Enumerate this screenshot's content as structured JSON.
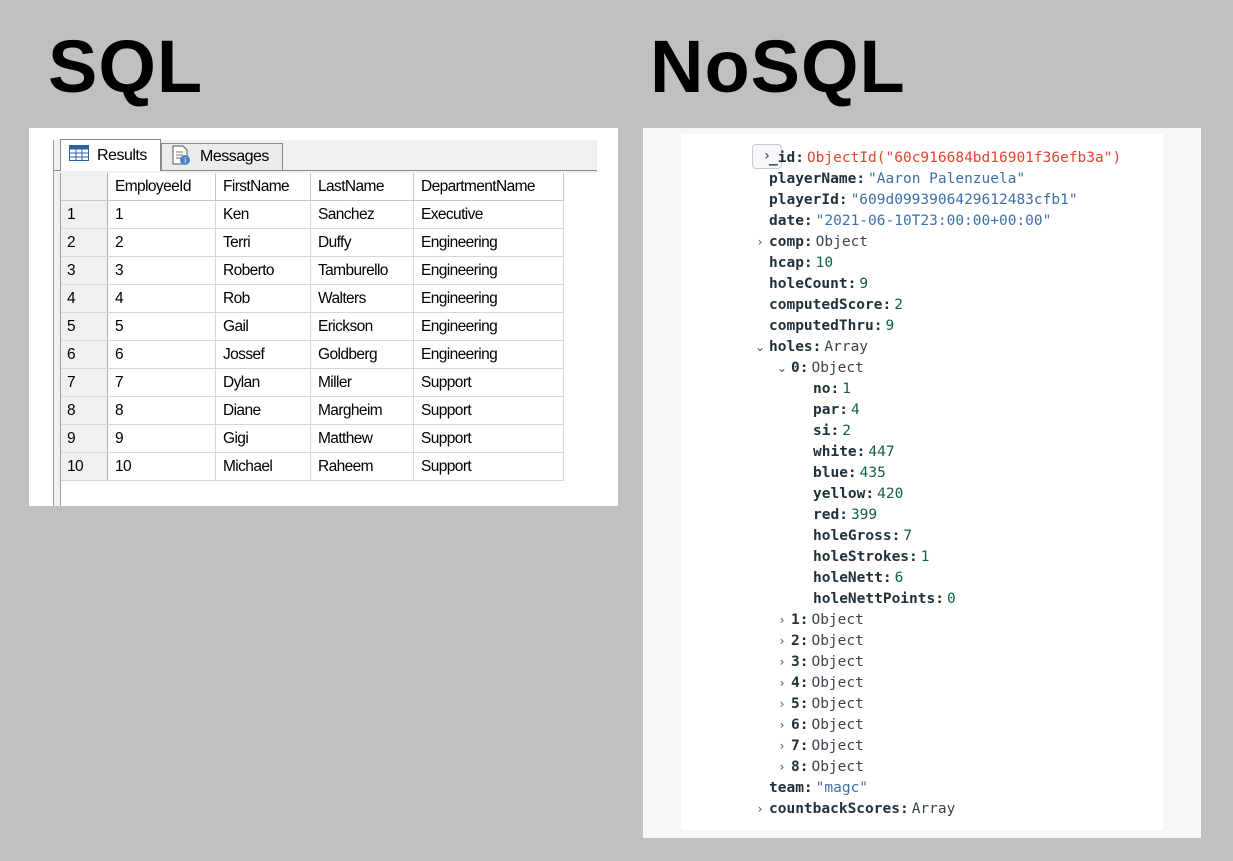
{
  "titles": {
    "sql": "SQL",
    "nosql": "NoSQL"
  },
  "sql": {
    "tabs": [
      {
        "label": "Results",
        "icon": "grid-icon"
      },
      {
        "label": "Messages",
        "icon": "messages-icon"
      }
    ],
    "columns": [
      "EmployeeId",
      "FirstName",
      "LastName",
      "DepartmentName"
    ],
    "rows": [
      {
        "num": "1",
        "id": "1",
        "first": "Ken",
        "last": "Sanchez",
        "dept": "Executive"
      },
      {
        "num": "2",
        "id": "2",
        "first": "Terri",
        "last": "Duffy",
        "dept": "Engineering"
      },
      {
        "num": "3",
        "id": "3",
        "first": "Roberto",
        "last": "Tamburello",
        "dept": "Engineering"
      },
      {
        "num": "4",
        "id": "4",
        "first": "Rob",
        "last": "Walters",
        "dept": "Engineering"
      },
      {
        "num": "5",
        "id": "5",
        "first": "Gail",
        "last": "Erickson",
        "dept": "Engineering"
      },
      {
        "num": "6",
        "id": "6",
        "first": "Jossef",
        "last": "Goldberg",
        "dept": "Engineering"
      },
      {
        "num": "7",
        "id": "7",
        "first": "Dylan",
        "last": "Miller",
        "dept": "Support"
      },
      {
        "num": "8",
        "id": "8",
        "first": "Diane",
        "last": "Margheim",
        "dept": "Support"
      },
      {
        "num": "9",
        "id": "9",
        "first": "Gigi",
        "last": "Matthew",
        "dept": "Support"
      },
      {
        "num": "10",
        "id": "10",
        "first": "Michael",
        "last": "Raheem",
        "dept": "Support"
      }
    ]
  },
  "nosql": {
    "expand_symbol": "›",
    "lines": [
      {
        "indent": 0,
        "key": "_id",
        "value": "ObjectId(\"60c916684bd16901f36efb3a\")",
        "type": "oid"
      },
      {
        "indent": 0,
        "key": "playerName",
        "value": "\"Aaron  Palenzuela\"",
        "type": "str"
      },
      {
        "indent": 0,
        "key": "playerId",
        "value": "\"609d0993906429612483cfb1\"",
        "type": "str"
      },
      {
        "indent": 0,
        "key": "date",
        "value": "\"2021-06-10T23:00:00+00:00\"",
        "type": "str"
      },
      {
        "indent": 0,
        "key": "comp",
        "value": "Object",
        "type": "type",
        "caret": "›"
      },
      {
        "indent": 0,
        "key": "hcap",
        "value": "10",
        "type": "num"
      },
      {
        "indent": 0,
        "key": "holeCount",
        "value": "9",
        "type": "num"
      },
      {
        "indent": 0,
        "key": "computedScore",
        "value": "2",
        "type": "num"
      },
      {
        "indent": 0,
        "key": "computedThru",
        "value": "9",
        "type": "num"
      },
      {
        "indent": 0,
        "key": "holes",
        "value": "Array",
        "type": "type",
        "caret": "⌄"
      },
      {
        "indent": 1,
        "key": "0",
        "value": "Object",
        "type": "type",
        "caret": "⌄"
      },
      {
        "indent": 2,
        "key": "no",
        "value": "1",
        "type": "num"
      },
      {
        "indent": 2,
        "key": "par",
        "value": "4",
        "type": "num"
      },
      {
        "indent": 2,
        "key": "si",
        "value": "2",
        "type": "num"
      },
      {
        "indent": 2,
        "key": "white",
        "value": "447",
        "type": "num"
      },
      {
        "indent": 2,
        "key": "blue",
        "value": "435",
        "type": "num"
      },
      {
        "indent": 2,
        "key": "yellow",
        "value": "420",
        "type": "num"
      },
      {
        "indent": 2,
        "key": "red",
        "value": "399",
        "type": "num"
      },
      {
        "indent": 2,
        "key": "holeGross",
        "value": "7",
        "type": "num"
      },
      {
        "indent": 2,
        "key": "holeStrokes",
        "value": "1",
        "type": "num"
      },
      {
        "indent": 2,
        "key": "holeNett",
        "value": "6",
        "type": "num"
      },
      {
        "indent": 2,
        "key": "holeNettPoints",
        "value": "0",
        "type": "num"
      },
      {
        "indent": 1,
        "key": "1",
        "value": "Object",
        "type": "type",
        "caret": "›"
      },
      {
        "indent": 1,
        "key": "2",
        "value": "Object",
        "type": "type",
        "caret": "›"
      },
      {
        "indent": 1,
        "key": "3",
        "value": "Object",
        "type": "type",
        "caret": "›"
      },
      {
        "indent": 1,
        "key": "4",
        "value": "Object",
        "type": "type",
        "caret": "›"
      },
      {
        "indent": 1,
        "key": "5",
        "value": "Object",
        "type": "type",
        "caret": "›"
      },
      {
        "indent": 1,
        "key": "6",
        "value": "Object",
        "type": "type",
        "caret": "›"
      },
      {
        "indent": 1,
        "key": "7",
        "value": "Object",
        "type": "type",
        "caret": "›"
      },
      {
        "indent": 1,
        "key": "8",
        "value": "Object",
        "type": "type",
        "caret": "›"
      },
      {
        "indent": 0,
        "key": "team",
        "value": "\"magc\"",
        "type": "str"
      },
      {
        "indent": 0,
        "key": "countbackScores",
        "value": "Array",
        "type": "type",
        "caret": "›"
      }
    ]
  }
}
